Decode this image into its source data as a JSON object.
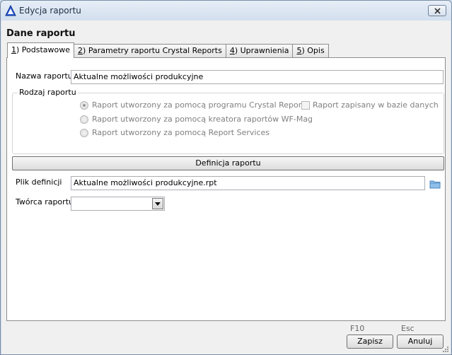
{
  "window": {
    "title": "Edycja raportu"
  },
  "header": {
    "section_title": "Dane raportu"
  },
  "tabs": [
    {
      "hotkey": "1",
      "label": ") Podstawowe"
    },
    {
      "hotkey": "2",
      "label": ") Parametry raportu Crystal Reports"
    },
    {
      "hotkey": "4",
      "label": ") Uprawnienia"
    },
    {
      "hotkey": "5",
      "label": ") Opis"
    }
  ],
  "form": {
    "report_name_label": "Nazwa raportu",
    "report_name_value": "Aktualne możliwości produkcyjne",
    "report_type_label": "Rodzaj raportu",
    "radio_options": [
      "Raport utworzony za pomocą programu Crystal Reports",
      "Raport utworzony za pomocą kreatora raportów WF-Mag",
      "Raport utworzony za pomocą Report Services"
    ],
    "saved_in_db_label": "Raport zapisany w bazie danych",
    "definition_button": "Definicja raportu",
    "definition_file_label": "Plik definicji",
    "definition_file_value": "Aktualne możliwości produkcyjne.rpt",
    "author_label": "Twórca raportu",
    "author_value": ""
  },
  "footer": {
    "save_hotkey": "F10",
    "save_label": "Zapisz",
    "cancel_hotkey": "Esc",
    "cancel_label": "Anuluj"
  },
  "colors": {
    "window_frame": "#7b8ea6",
    "client_bg": "#f0f0f0",
    "disabled_text": "#808080",
    "folder": "#5a9bd5"
  }
}
